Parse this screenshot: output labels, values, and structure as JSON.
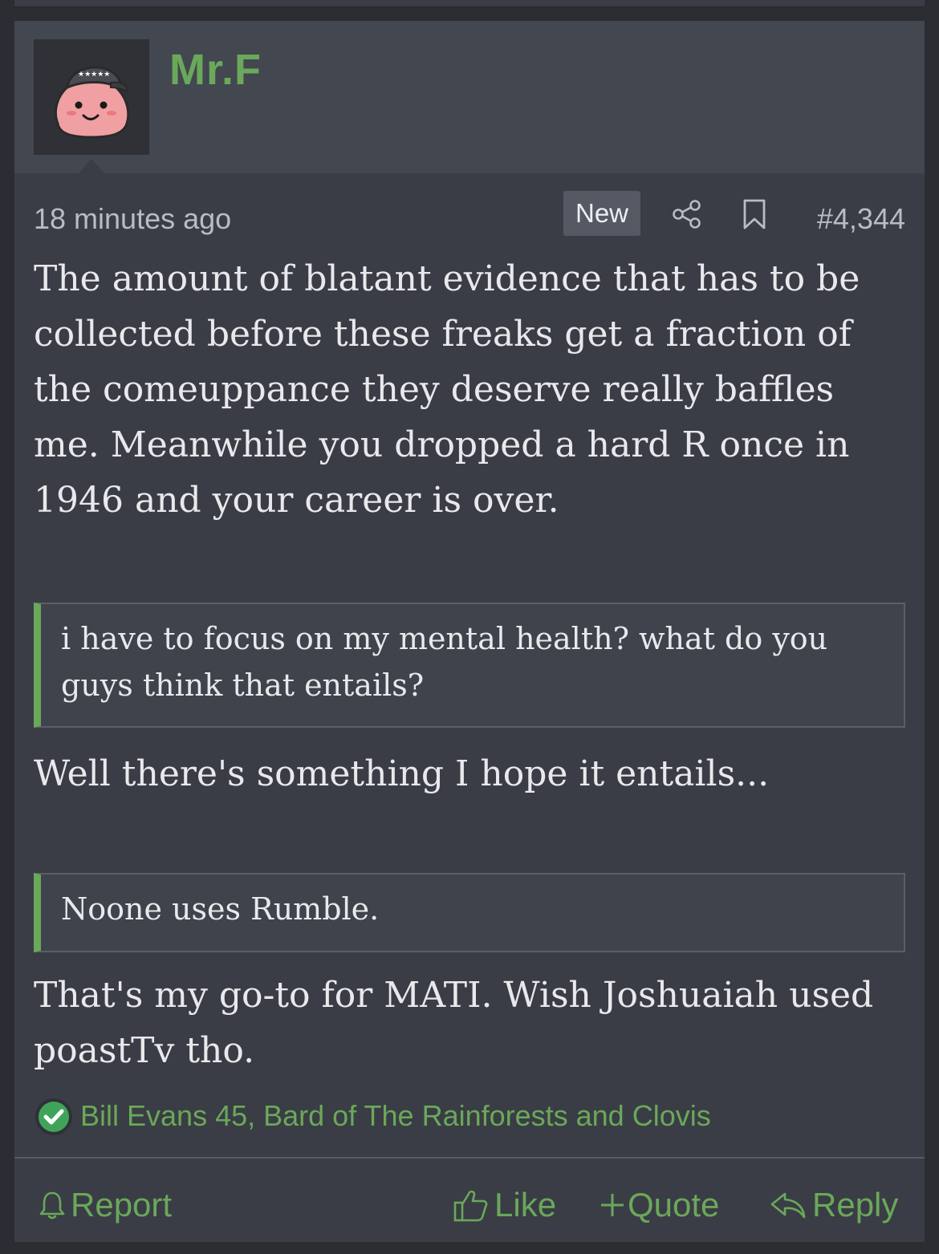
{
  "post": {
    "author": "Mr.F",
    "timestamp": "18 minutes ago",
    "badge": "New",
    "post_number": "#4,344",
    "paragraphs": [
      "The amount of blatant evidence that has to be collected before these freaks get a fraction of the comeuppance they deserve really baffles me. Meanwhile you dropped a hard R once in 1946 and your career is over.",
      "Well there's something I hope it entails...",
      "That's my go-to for MATI. Wish Joshuaiah used poastTv tho."
    ],
    "quotes": [
      "i have to focus on my mental health? what do you guys think that entails?",
      "Noone uses Rumble."
    ],
    "reactions": {
      "icon": "checkmark-icon",
      "text": "Bill Evans 45, Bard of The Rainforests and Clovis"
    }
  },
  "actions": {
    "report": "Report",
    "like": "Like",
    "quote": "Quote",
    "reply": "Reply"
  },
  "icons": {
    "share": "share-icon",
    "bookmark": "bookmark-icon",
    "report": "bell-icon",
    "like": "thumbs-up-icon",
    "quote": "plus-icon",
    "reply": "reply-arrow-icon"
  },
  "colors": {
    "accent": "#6aa85a",
    "background": "#3a3d45",
    "header": "#434750",
    "text": "#e8e9ec",
    "muted": "#b9bcc3"
  }
}
